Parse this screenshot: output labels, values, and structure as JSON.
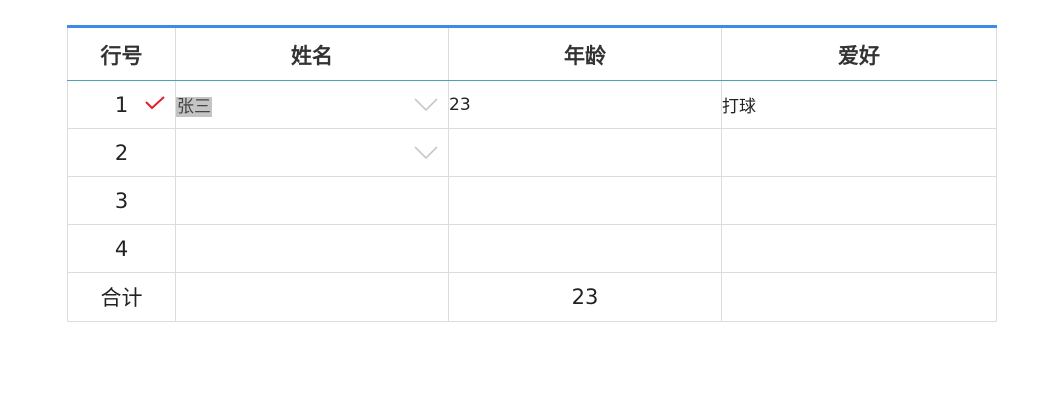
{
  "table": {
    "headers": [
      "行号",
      "姓名",
      "年龄",
      "爱好"
    ],
    "rows": [
      {
        "num": "1",
        "name": "张三",
        "age": "23",
        "hobby": "打球"
      },
      {
        "num": "2",
        "name": "",
        "age": "",
        "hobby": ""
      },
      {
        "num": "3",
        "name": "",
        "age": "",
        "hobby": ""
      },
      {
        "num": "4",
        "name": "",
        "age": "",
        "hobby": ""
      }
    ],
    "footer": {
      "label": "合计",
      "name_total": "",
      "age_total": "23",
      "hobby_total": ""
    }
  },
  "icons": {
    "check": "check-icon",
    "dropdown": "chevron-down-icon"
  },
  "colors": {
    "header_top_border": "#3d8ae8",
    "header_bottom_border": "#4aa6b7",
    "check_mark": "#e0202a",
    "chevron": "#c8c8c8",
    "selection_highlight": "#c4c4c4"
  }
}
